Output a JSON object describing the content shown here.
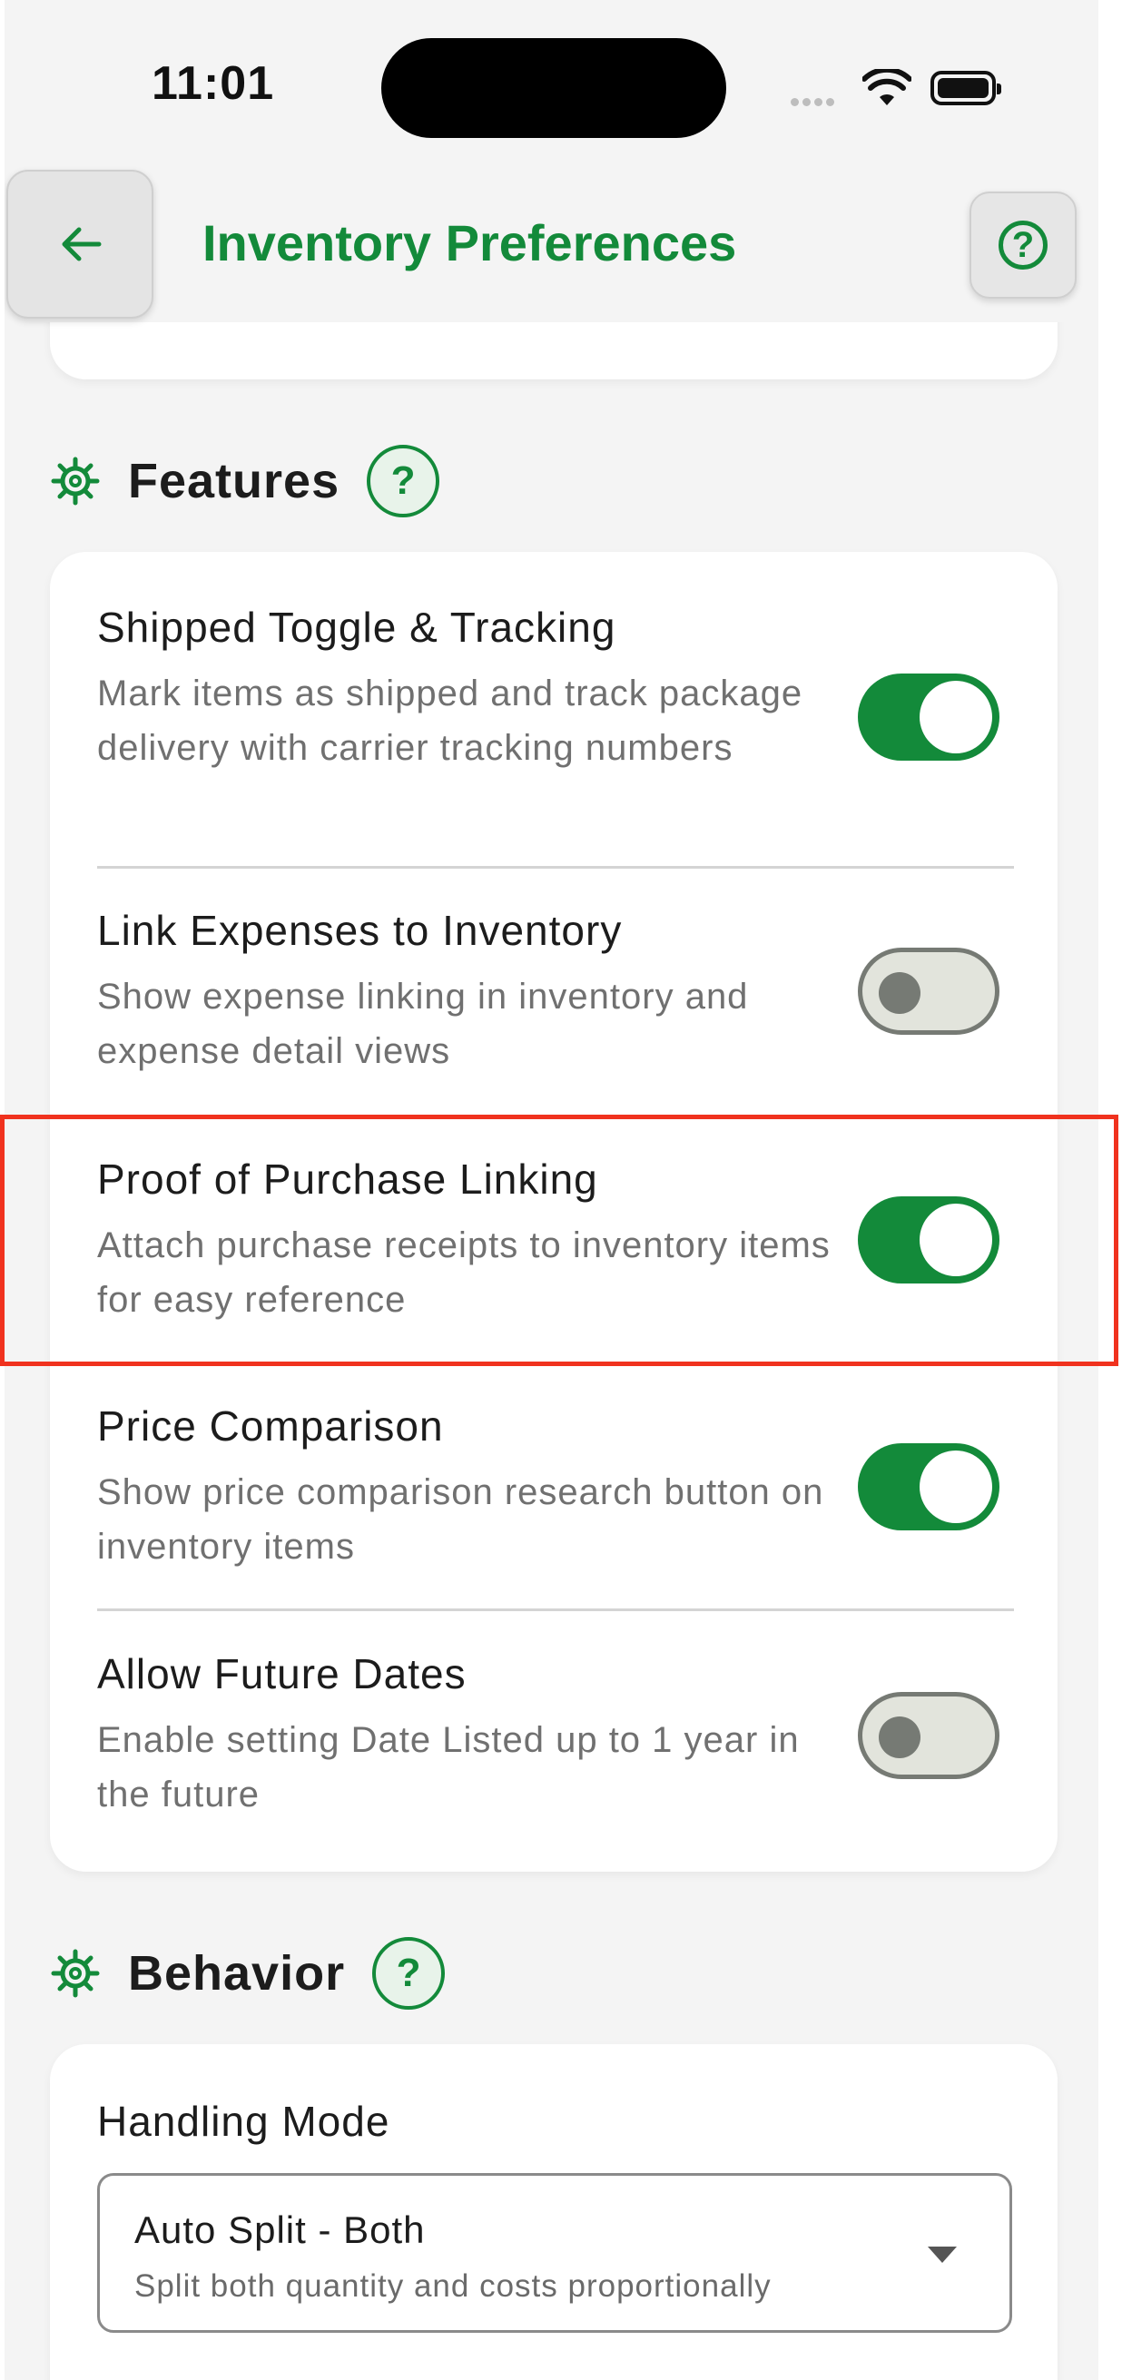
{
  "status_bar": {
    "time": "11:01"
  },
  "header": {
    "title": "Inventory Preferences"
  },
  "features": {
    "heading": "Features",
    "help": "?",
    "items": [
      {
        "title": "Shipped Toggle & Tracking",
        "description": "Mark items as shipped and track package delivery with carrier tracking numbers",
        "enabled": true
      },
      {
        "title": "Link Expenses to Inventory",
        "description": "Show expense linking in inventory and expense detail views",
        "enabled": false
      },
      {
        "title": "Proof of Purchase Linking",
        "description": "Attach purchase receipts to inventory items for easy reference",
        "enabled": true
      },
      {
        "title": "Price Comparison",
        "description": "Show price comparison research button on inventory items",
        "enabled": true
      },
      {
        "title": "Allow Future Dates",
        "description": "Enable setting Date Listed up to 1 year in the future",
        "enabled": false
      }
    ]
  },
  "behavior": {
    "heading": "Behavior",
    "help": "?",
    "handling_mode": {
      "label": "Handling Mode",
      "value": "Auto Split - Both",
      "description": "Split both quantity and costs proportionally"
    }
  },
  "colors": {
    "accent": "#138a3a",
    "highlight": "#f0321e",
    "toggle_off": "#e2e4dc"
  }
}
